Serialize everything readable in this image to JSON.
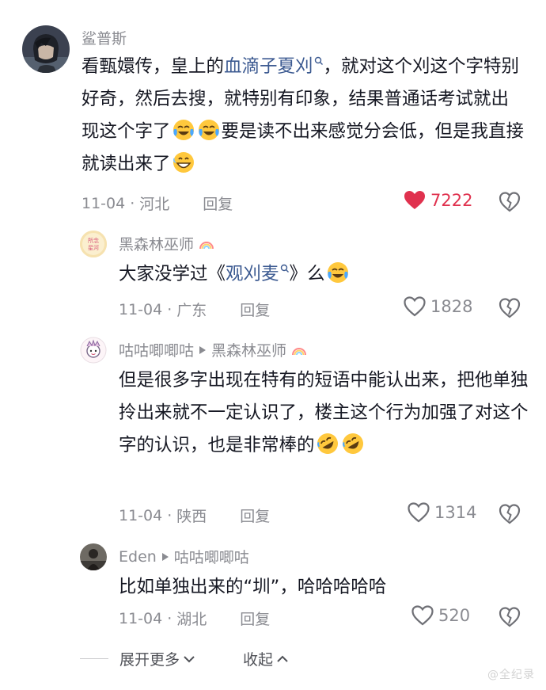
{
  "comments": [
    {
      "username": "鲨普斯",
      "text_pre": "看甄嬛传，皇上的",
      "link": "血滴子夏刈",
      "text_post": "，就对这个刈这个字特别好奇，然后去搜，就特别有印象，结果普通话考试就出现这个字了",
      "text_mid": "要是读不出来感觉分会低，但是我直接就读出来了",
      "date": "11-04",
      "location": "河北",
      "reply": "回复",
      "likes": "7222",
      "liked": true
    },
    {
      "username": "黑森林巫师",
      "text_pre": "大家没学过《",
      "link": "观刈麦",
      "text_post": "》么",
      "date": "11-04",
      "location": "广东",
      "reply": "回复",
      "likes": "1828"
    },
    {
      "username": "咕咕唧唧咕",
      "reply_to": "黑森林巫师",
      "text": "但是很多字出现在特有的短语中能认出来，把他单独拎出来就不一定认识了，楼主这个行为加强了对这个字的认识，也是非常棒的",
      "date": "11-04",
      "location": "陕西",
      "reply": "回复",
      "likes": "1314"
    },
    {
      "username": "Eden",
      "reply_to": "咕咕唧唧咕",
      "text": "比如单独出来的“圳”，哈哈哈哈哈",
      "date": "11-04",
      "location": "湖北",
      "reply": "回复",
      "likes": "520"
    }
  ],
  "footer": {
    "expand_more": "展开更多",
    "collapse": "收起"
  },
  "avatar2_text": "所念皆星河",
  "watermark": "@全纪录",
  "colors": {
    "liked": "#e0314e",
    "link": "#3c5a91",
    "meta": "#8a8b91"
  }
}
